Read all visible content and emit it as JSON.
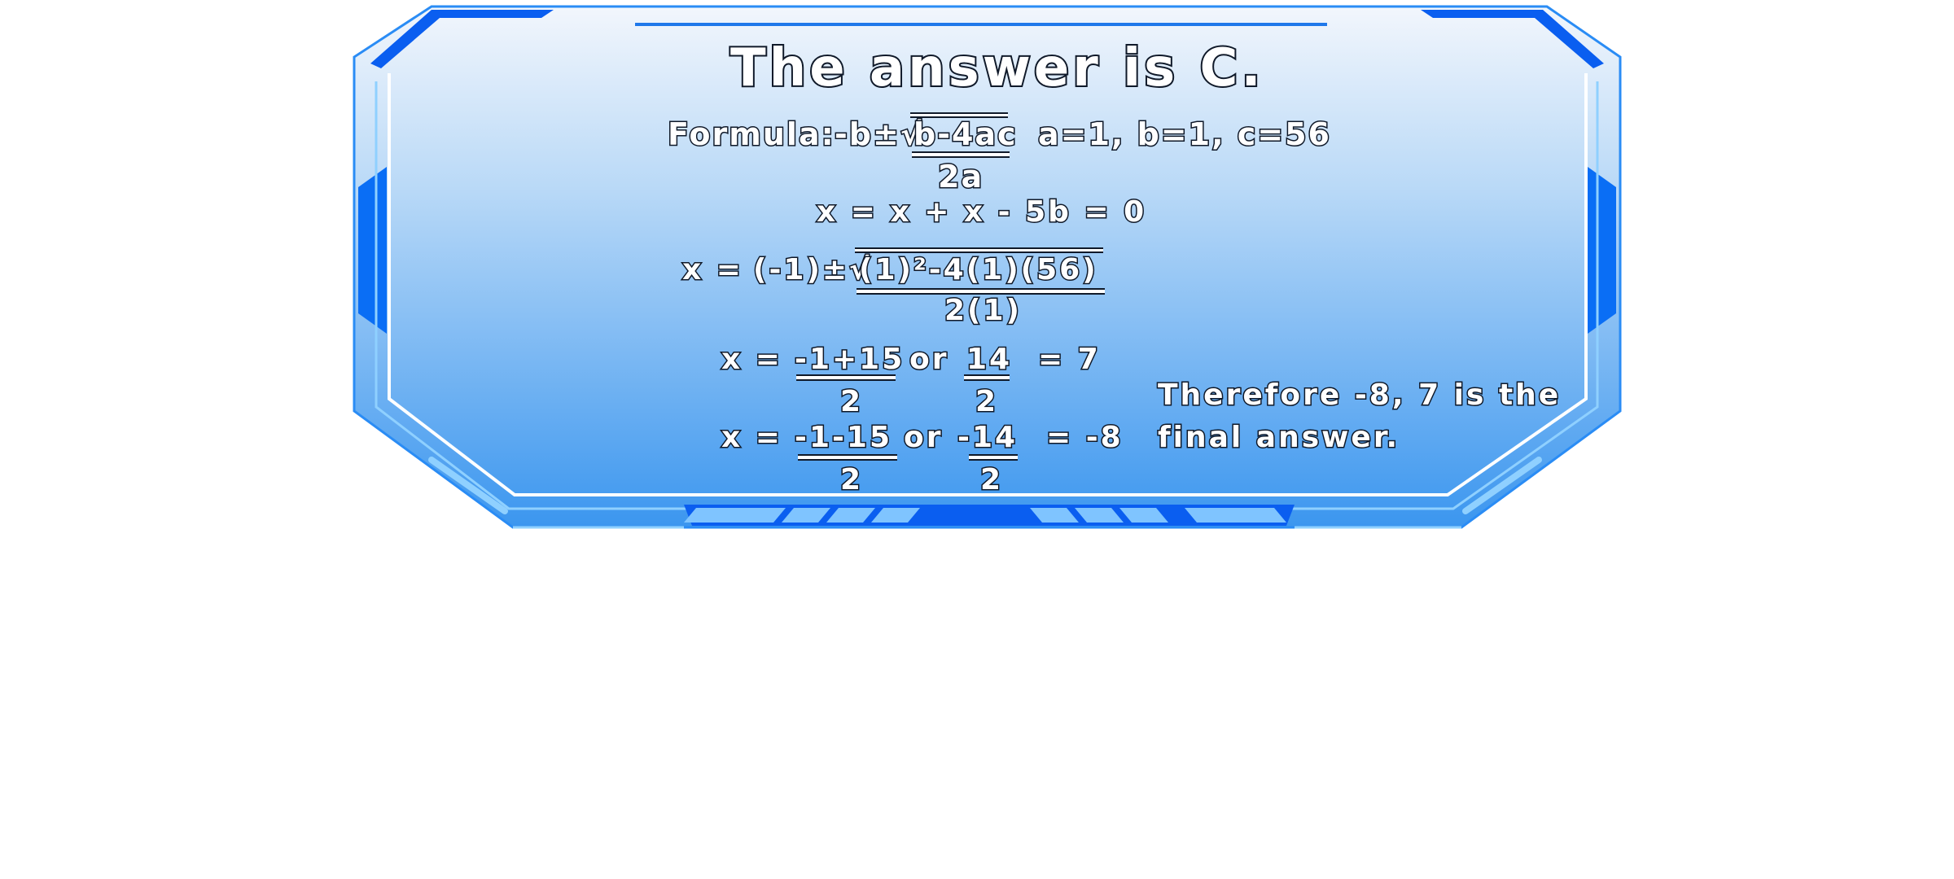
{
  "title": "The answer is C.",
  "formula": {
    "prefix": "Formula:",
    "numerator_left": "-b±√",
    "radicand": "b-4ac",
    "denominator": "2a",
    "values": "a=1, b=1, c=56"
  },
  "equation_line": "x = x + x - 5b = 0",
  "substitution": {
    "lhs": "x =",
    "numerator_left": "(-1)±√",
    "radicand": "(1)²-4(1)(56)",
    "denominator": "2(1)"
  },
  "solution_plus": {
    "lhs": "x =",
    "frac1_num": "-1+15",
    "frac1_den": "2",
    "or": "or",
    "frac2_num": "14",
    "frac2_den": "2",
    "result": "= 7"
  },
  "solution_minus": {
    "lhs": "x =",
    "frac1_num": "-1-15",
    "frac1_den": "2",
    "or": "or",
    "frac2_num": "-14",
    "frac2_den": "2",
    "result": "= -8"
  },
  "conclusion": {
    "line1": "Therefore -8, 7 is the",
    "line2": "final answer."
  },
  "colors": {
    "panel_top": "#eef4fb",
    "panel_bottom": "#3d98f0",
    "frame_blue": "#0a5ef0",
    "frame_light": "#7fc4ff",
    "text_fill": "#ffffff",
    "text_outline": "#101a2a"
  }
}
